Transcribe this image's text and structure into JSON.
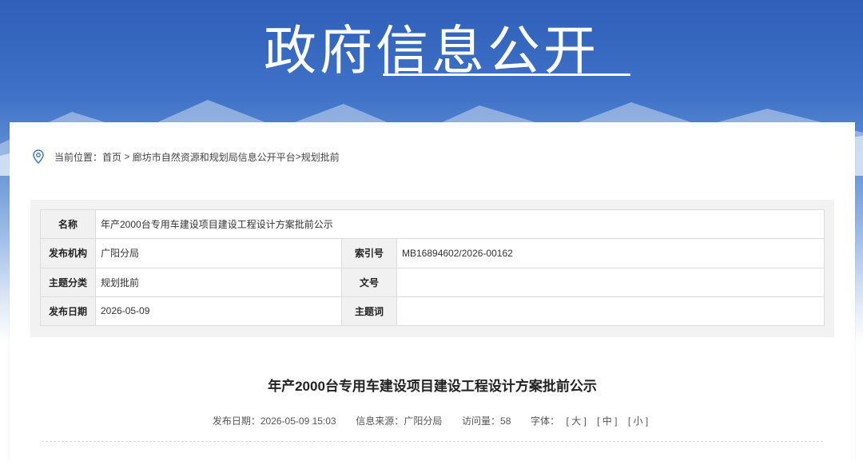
{
  "banner": {
    "title": "政府信息公开"
  },
  "breadcrumb": {
    "prefix": "当前位置：",
    "home": "首页",
    "sep": " > ",
    "platform": "廊坊市自然资源和规划局信息公开平台",
    "sep2": ">",
    "current": "规划批前"
  },
  "info_table": {
    "name_label": "名称",
    "name_value": "年产2000台专用车建设项目建设工程设计方案批前公示",
    "publisher_label": "发布机构",
    "publisher_value": "广阳分局",
    "index_label": "索引号",
    "index_value": "MB16894602/2026-00162",
    "topic_label": "主题分类",
    "topic_value": "规划批前",
    "docno_label": "文号",
    "docno_value": "",
    "date_label": "发布日期",
    "date_value": "2026-05-09",
    "keyword_label": "主题词",
    "keyword_value": ""
  },
  "article": {
    "title": "年产2000台专用车建设项目建设工程设计方案批前公示",
    "meta": {
      "date_label": "发布日期：",
      "date_value": "2026-05-09 15:03",
      "source_label": "信息来源：",
      "source_value": "广阳分局",
      "views_label": "访问量：",
      "views_value": "58",
      "font_label": "字体：",
      "font_large": "[ 大 ]",
      "font_medium": "[ 中 ]",
      "font_small": "[ 小 ]"
    }
  },
  "colors": {
    "banner_blue": "#3f72c8",
    "table_label_bg": "#f1f1f1"
  }
}
